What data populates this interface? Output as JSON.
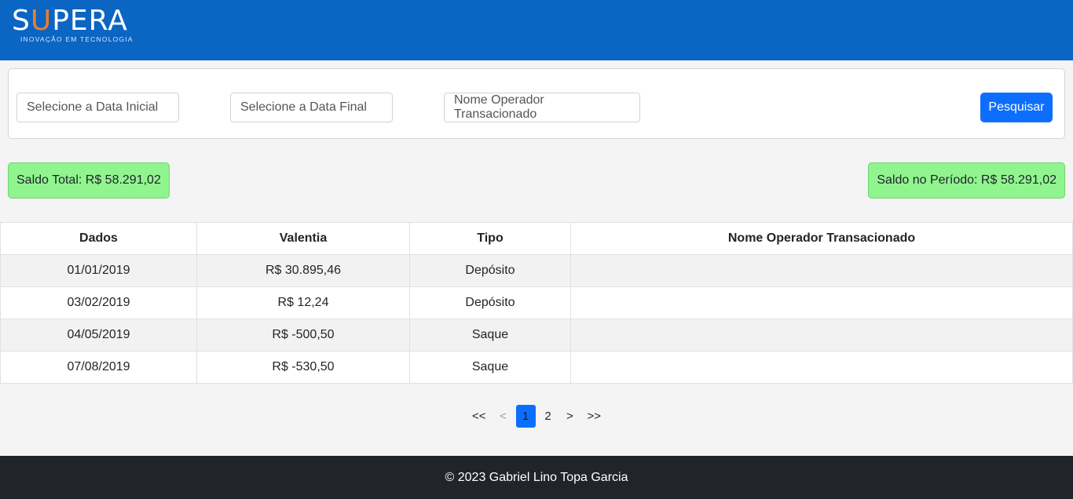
{
  "header": {
    "logo_main": "SUPERA",
    "logo_tagline": "INOVAÇÃO EM TECNOLOGIA"
  },
  "filters": {
    "start_date_placeholder": "Selecione a Data Inicial",
    "end_date_placeholder": "Selecione a Data Final",
    "operator_placeholder": "Nome Operador Transacionado",
    "search_label": "Pesquisar"
  },
  "balances": {
    "total": "Saldo Total: R$ 58.291,02",
    "period": "Saldo no Período: R$ 58.291,02"
  },
  "table": {
    "headers": [
      "Dados",
      "Valentia",
      "Tipo",
      "Nome Operador Transacionado"
    ],
    "rows": [
      [
        "01/01/2019",
        "R$ 30.895,46",
        "Depósito",
        ""
      ],
      [
        "03/02/2019",
        "R$ 12,24",
        "Depósito",
        ""
      ],
      [
        "04/05/2019",
        "R$ -500,50",
        "Saque",
        ""
      ],
      [
        "07/08/2019",
        "R$ -530,50",
        "Saque",
        ""
      ]
    ]
  },
  "pagination": {
    "first": "<<",
    "prev": "<",
    "pages": [
      "1",
      "2"
    ],
    "current": "1",
    "next": ">",
    "last": ">>"
  },
  "footer": {
    "text": "© 2023 Gabriel Lino Topa Garcia"
  },
  "colors": {
    "header_bg": "#0b65c2",
    "logo_accent": "#f07d27",
    "primary": "#0d6efd",
    "balance_bg": "#90f58f",
    "footer_bg": "#212529"
  }
}
